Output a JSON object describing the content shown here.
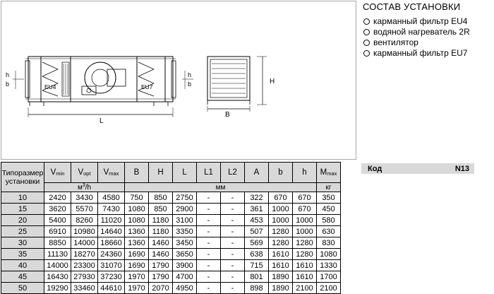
{
  "composition": {
    "heading": "СОСТАВ УСТАНОВКИ",
    "items": [
      {
        "label": "карманный фильтр EU4"
      },
      {
        "label": "водяной нагреватель 2R"
      },
      {
        "label": "вентилятор"
      },
      {
        "label": "карманный фильтр EU7"
      }
    ]
  },
  "code": {
    "label": "Код",
    "value": "N13"
  },
  "drawing": {
    "side_labels": {
      "h": "h",
      "b": "b",
      "filter_left": "EU4",
      "filter_right": "EU7",
      "length": "L"
    },
    "front_labels": {
      "height": "H",
      "width": "B"
    }
  },
  "table": {
    "type_header": "Типоразмер установки",
    "columns": [
      {
        "main": "V",
        "sub": "min"
      },
      {
        "main": "V",
        "sub": "opt"
      },
      {
        "main": "V",
        "sub": "max"
      },
      {
        "main": "B",
        "sub": ""
      },
      {
        "main": "H",
        "sub": ""
      },
      {
        "main": "L",
        "sub": ""
      },
      {
        "main": "L1",
        "sub": ""
      },
      {
        "main": "L2",
        "sub": ""
      },
      {
        "main": "A",
        "sub": ""
      },
      {
        "main": "b",
        "sub": ""
      },
      {
        "main": "h",
        "sub": ""
      },
      {
        "main": "M",
        "sub": "max"
      }
    ],
    "units": {
      "flow_base": "м",
      "flow_sup": "3",
      "flow_tail": "/h",
      "dimensions": "мм",
      "mass": "кг"
    },
    "rows": [
      {
        "size": "10",
        "cells": [
          "2420",
          "3430",
          "4580",
          "750",
          "850",
          "2750",
          "-",
          "-",
          "322",
          "670",
          "670",
          "350"
        ]
      },
      {
        "size": "15",
        "cells": [
          "3620",
          "5570",
          "7430",
          "1080",
          "850",
          "2900",
          "-",
          "-",
          "361",
          "1000",
          "670",
          "450"
        ]
      },
      {
        "size": "20",
        "cells": [
          "5400",
          "8260",
          "11020",
          "1080",
          "1180",
          "3100",
          "-",
          "-",
          "453",
          "1000",
          "1000",
          "580"
        ]
      },
      {
        "size": "25",
        "cells": [
          "6910",
          "10980",
          "14640",
          "1360",
          "1180",
          "3350",
          "-",
          "-",
          "507",
          "1280",
          "1000",
          "630"
        ]
      },
      {
        "size": "30",
        "cells": [
          "8850",
          "14000",
          "18660",
          "1360",
          "1460",
          "3450",
          "-",
          "-",
          "569",
          "1280",
          "1280",
          "830"
        ]
      },
      {
        "size": "35",
        "cells": [
          "11130",
          "18270",
          "24360",
          "1690",
          "1460",
          "3650",
          "-",
          "-",
          "638",
          "1610",
          "1280",
          "1080"
        ]
      },
      {
        "size": "40",
        "cells": [
          "14000",
          "23300",
          "31070",
          "1690",
          "1790",
          "3900",
          "-",
          "-",
          "715",
          "1610",
          "1610",
          "1330"
        ]
      },
      {
        "size": "45",
        "cells": [
          "16430",
          "27930",
          "37230",
          "1970",
          "1790",
          "4700",
          "-",
          "-",
          "801",
          "1890",
          "1610",
          "1700"
        ]
      },
      {
        "size": "50",
        "cells": [
          "19290",
          "33460",
          "44610",
          "1970",
          "2070",
          "4950",
          "-",
          "-",
          "898",
          "1890",
          "2100",
          "2100"
        ]
      }
    ]
  }
}
